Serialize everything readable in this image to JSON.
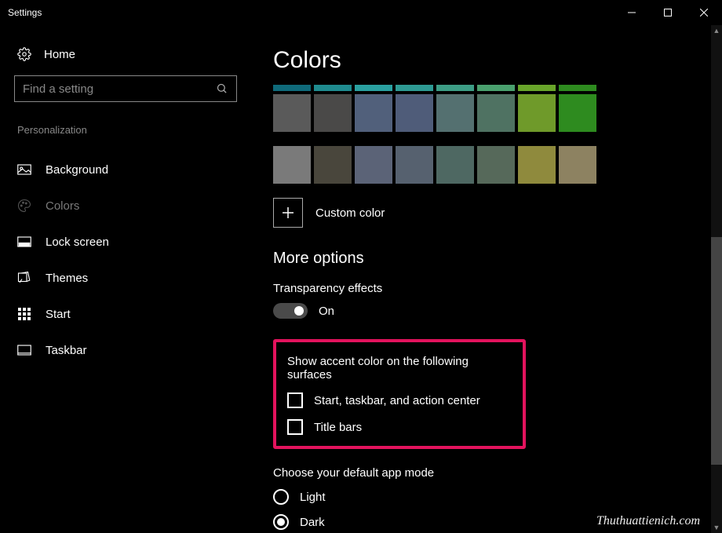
{
  "window": {
    "title": "Settings"
  },
  "sidebar": {
    "home": "Home",
    "search_placeholder": "Find a setting",
    "category": "Personalization",
    "items": [
      {
        "label": "Background",
        "icon": "image-icon"
      },
      {
        "label": "Colors",
        "icon": "palette-icon",
        "active": true
      },
      {
        "label": "Lock screen",
        "icon": "lockscreen-icon"
      },
      {
        "label": "Themes",
        "icon": "themes-icon"
      },
      {
        "label": "Start",
        "icon": "start-icon"
      },
      {
        "label": "Taskbar",
        "icon": "taskbar-icon"
      }
    ]
  },
  "main": {
    "title": "Colors",
    "top_row_colors": [
      "#0f6a7a",
      "#1f8b8f",
      "#2aa0a0",
      "#2e9a93",
      "#3d9d85",
      "#4aa06e",
      "#69a52a",
      "#2e8b1f"
    ],
    "color_rows": [
      [
        "#5a5a5a",
        "#4a4948",
        "#51607b",
        "#4f5c79",
        "#547070",
        "#4f7262",
        "#6f9a2a",
        "#2e8b1f"
      ],
      [
        "#7a7a7a",
        "#49463c",
        "#5b6377",
        "#56616f",
        "#4e6862",
        "#56695a",
        "#8f8a3d",
        "#8d8261"
      ]
    ],
    "custom_color": "Custom color",
    "more_options": "More options",
    "transparency_label": "Transparency effects",
    "transparency_value": "On",
    "accent_section": "Show accent color on the following surfaces",
    "checkboxes": [
      {
        "label": "Start, taskbar, and action center",
        "checked": false
      },
      {
        "label": "Title bars",
        "checked": false
      }
    ],
    "default_mode_label": "Choose your default app mode",
    "radio_options": [
      {
        "label": "Light",
        "selected": false
      },
      {
        "label": "Dark",
        "selected": true
      }
    ]
  },
  "watermark": "Thuthuattienich.com"
}
